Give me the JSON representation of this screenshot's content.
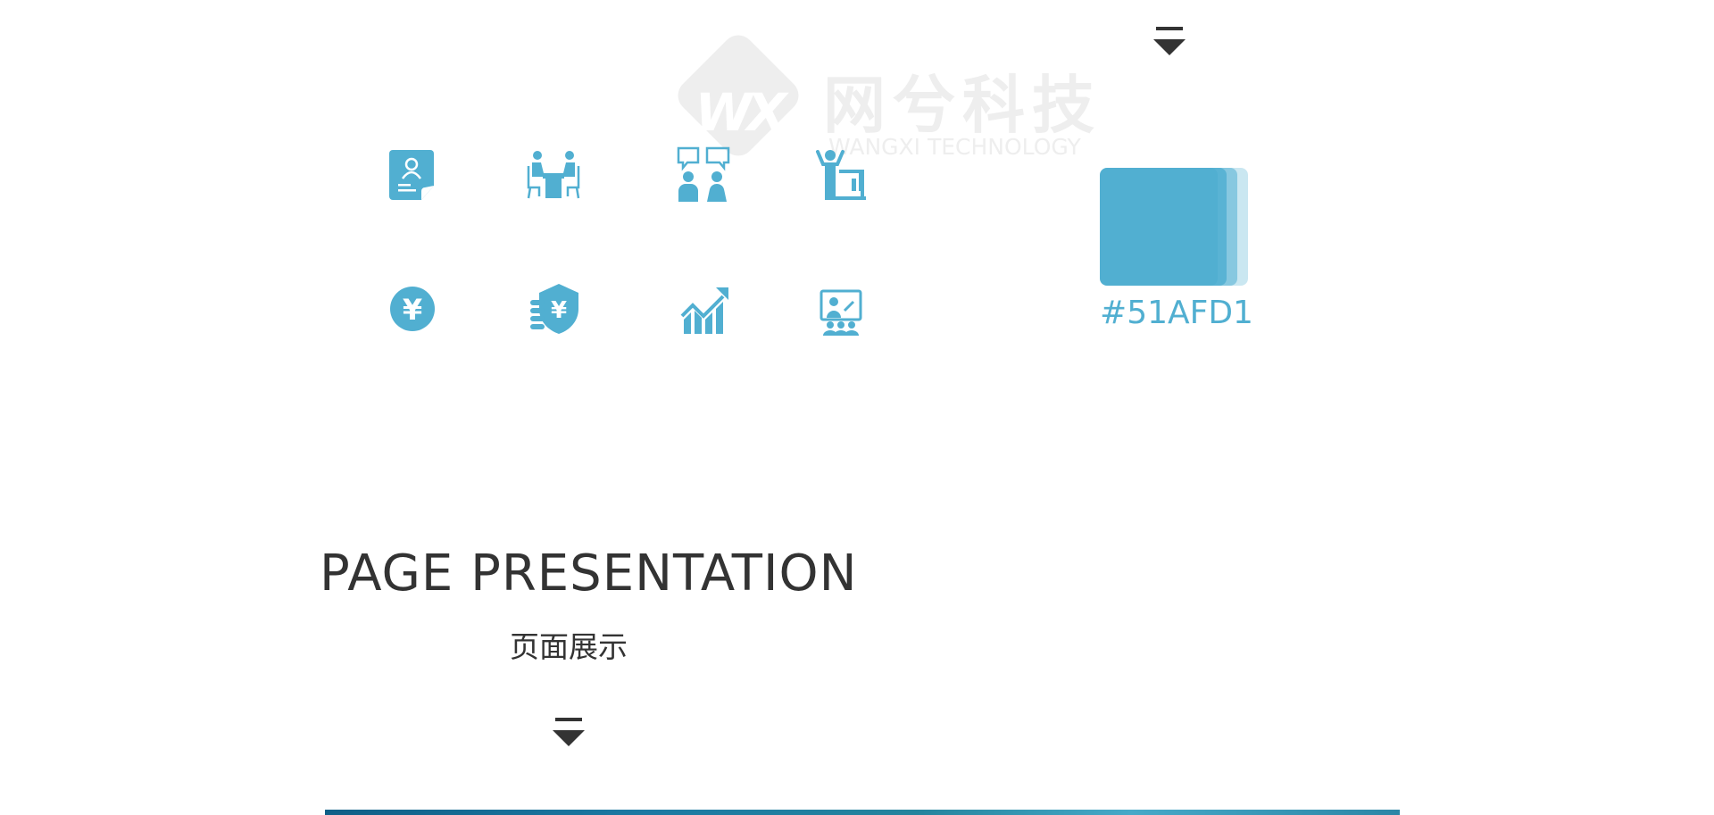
{
  "watermark": {
    "mark_text": "WX",
    "name_cn": "网兮科技",
    "name_en": "WANGXI TECHNOLOGY"
  },
  "icons": [
    {
      "name": "contact-card-icon",
      "row": 1,
      "col": 1
    },
    {
      "name": "meeting-table-icon",
      "row": 1,
      "col": 2
    },
    {
      "name": "conversation-icon",
      "row": 1,
      "col": 3
    },
    {
      "name": "presenter-icon",
      "row": 1,
      "col": 4
    },
    {
      "name": "yen-coin-icon",
      "row": 2,
      "col": 1
    },
    {
      "name": "yen-shield-icon",
      "row": 2,
      "col": 2
    },
    {
      "name": "growth-chart-icon",
      "row": 2,
      "col": 3
    },
    {
      "name": "video-conference-icon",
      "row": 2,
      "col": 4
    }
  ],
  "swatch": {
    "color": "#51AFD1",
    "label": "#51AFD1"
  },
  "section": {
    "title_en": "PAGE PRESENTATION",
    "title_cn": "页面展示"
  },
  "colors": {
    "accent": "#51AFD1",
    "text": "#333333",
    "watermark": "#EEEEEE"
  }
}
